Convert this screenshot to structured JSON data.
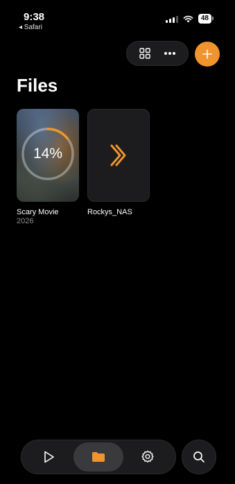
{
  "status_bar": {
    "time": "9:38",
    "back_app": "◂ Safari",
    "battery": "48"
  },
  "toolbar": {
    "grid_icon": "grid-view-icon",
    "more_icon": "ellipsis-icon",
    "add_icon": "plus-icon"
  },
  "page": {
    "title": "Files"
  },
  "items": [
    {
      "title": "Scary Movie",
      "subtitle": "2026",
      "progress_label": "14%",
      "progress": 0.14,
      "type": "movie"
    },
    {
      "title": "Rockys_NAS",
      "type": "folder",
      "icon": "chevron-right-icon"
    }
  ],
  "tab_bar": {
    "tabs": [
      {
        "icon": "play-icon",
        "active": false
      },
      {
        "icon": "folder-icon",
        "active": true
      },
      {
        "icon": "settings-gear-icon",
        "active": false
      }
    ],
    "search_icon": "search-icon"
  },
  "colors": {
    "accent": "#f0952e",
    "background": "#000000",
    "surface": "#1c1c1e",
    "secondary_text": "#8e8e93"
  }
}
